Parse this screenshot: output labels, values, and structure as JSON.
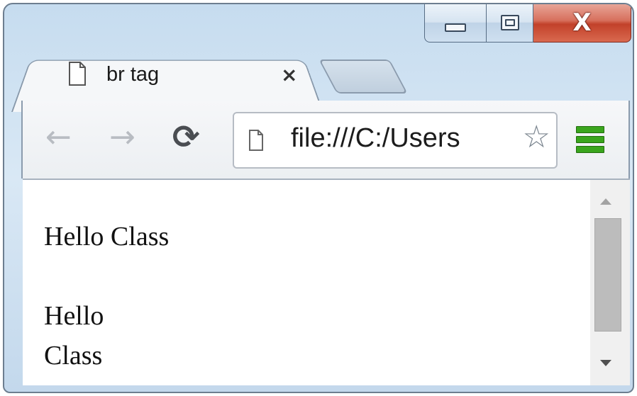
{
  "window": {
    "caption_buttons": [
      "minimize",
      "maximize",
      "close"
    ],
    "close_glyph": "X"
  },
  "tab": {
    "title": "br tag",
    "close_glyph": "×",
    "icon": "page-icon"
  },
  "toolbar": {
    "back_icon": "arrow-left-icon",
    "forward_icon": "arrow-right-icon",
    "reload_icon": "reload-icon",
    "url": "file:///C:/Users",
    "star_icon": "star-icon",
    "menu_icon": "hamburger-menu-icon"
  },
  "page": {
    "line1": "Hello Class",
    "line2": "Hello",
    "line3": "Class"
  },
  "colors": {
    "menu_green": "#3aa51d",
    "close_red": "#c2412a"
  }
}
